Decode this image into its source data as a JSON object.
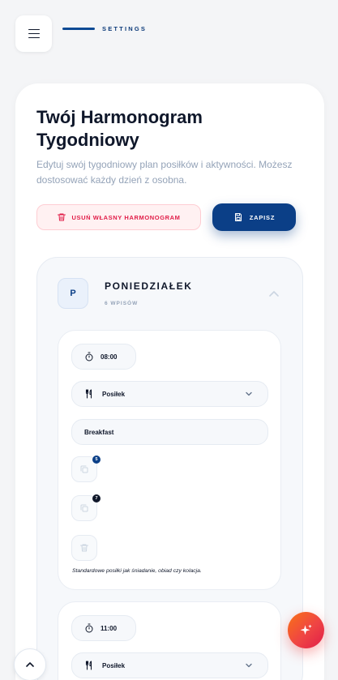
{
  "header": {
    "section_label": "SETTINGS"
  },
  "page": {
    "title": "Twój Harmonogram Tygodniowy",
    "subtitle": "Edytuj swój tygodniowy plan posiłków i aktywności. Możesz dostosować każdy dzień z osobna."
  },
  "actions": {
    "delete_label": "USUŃ WŁASNY HARMONOGRAM",
    "save_label": "ZAPISZ"
  },
  "day": {
    "initial": "P",
    "name": "PONIEDZIAŁEK",
    "count_label": "6 WPISÓW",
    "entries": [
      {
        "time": "08:00",
        "type": "Posiłek",
        "name": "Breakfast",
        "badge_a": "5",
        "badge_b": "7",
        "hint": "Standardowe posiłki jak śniadanie, obiad czy kolacja."
      },
      {
        "time": "11:00",
        "type": "Posiłek"
      }
    ]
  },
  "colors": {
    "primary": "#0b3f87",
    "danger": "#e11d48",
    "fab_gradient_start": "#f97316",
    "fab_gradient_end": "#e11d48"
  }
}
